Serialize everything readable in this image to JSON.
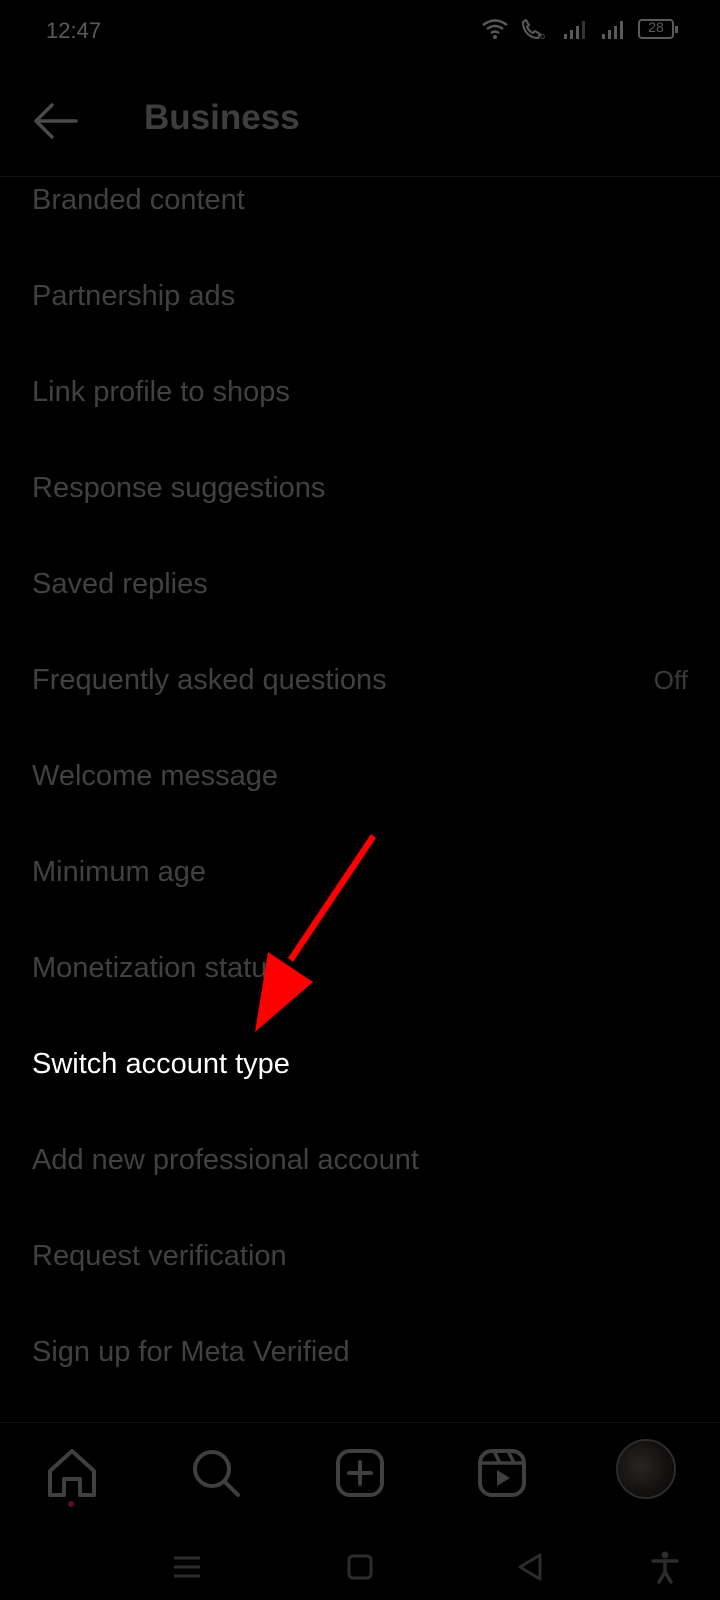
{
  "status_bar": {
    "time": "12:47",
    "battery": "28"
  },
  "header": {
    "title": "Business"
  },
  "settings": [
    {
      "label": "Branded content",
      "value": ""
    },
    {
      "label": "Partnership ads",
      "value": ""
    },
    {
      "label": "Link profile to shops",
      "value": ""
    },
    {
      "label": "Response suggestions",
      "value": ""
    },
    {
      "label": "Saved replies",
      "value": ""
    },
    {
      "label": "Frequently asked questions",
      "value": "Off"
    },
    {
      "label": "Welcome message",
      "value": ""
    },
    {
      "label": "Minimum age",
      "value": ""
    },
    {
      "label": "Monetization status",
      "value": ""
    },
    {
      "label": "Switch account type",
      "value": ""
    },
    {
      "label": "Add new professional account",
      "value": ""
    },
    {
      "label": "Request verification",
      "value": ""
    },
    {
      "label": "Sign up for Meta Verified",
      "value": ""
    }
  ],
  "highlight_item": "Switch account type",
  "bottom_nav": [
    "home-icon",
    "search-icon",
    "create-icon",
    "reels-icon",
    "profile-avatar"
  ],
  "colors": {
    "background": "#000000",
    "annotation_arrow": "#ff0000",
    "active_text": "#ffffff"
  }
}
